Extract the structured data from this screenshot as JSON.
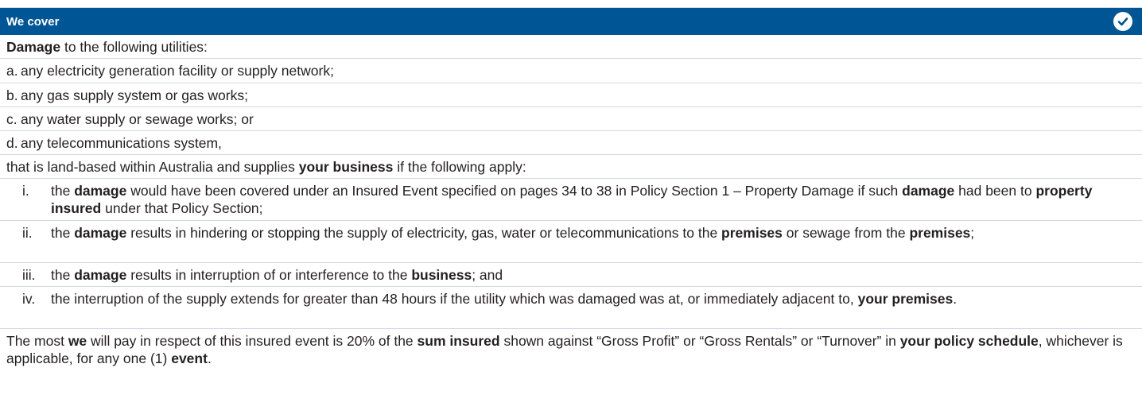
{
  "header": {
    "title": "We cover",
    "icon": "check-circle-icon",
    "bg": "#005694"
  },
  "intro": {
    "b1": "Damage",
    "t1": " to the following utilities:"
  },
  "list": [
    {
      "label": "a.",
      "text": "any electricity generation facility or supply network;"
    },
    {
      "label": "b.",
      "text": "any gas supply system or gas works;"
    },
    {
      "label": "c.",
      "text": "any water supply or sewage works; or"
    },
    {
      "label": "d.",
      "text": "any telecommunications system,"
    }
  ],
  "condition": {
    "t1": "that is land-based within Australia and supplies ",
    "b1": "your business",
    "t2": " if the following apply:"
  },
  "sub": {
    "i": {
      "label": "i.",
      "t1": "the ",
      "b1": "damage",
      "t2": " would have been covered under an Insured Event specified on pages 34 to 38 in Policy Section 1 – Property Damage if such ",
      "b2": "damage",
      "t3": " had been to ",
      "b3": "property insured",
      "t4": " under that Policy Section;"
    },
    "ii": {
      "label": "ii.",
      "t1": "the ",
      "b1": "damage",
      "t2": " results in hindering or stopping the supply of electricity, gas, water or telecommunications to the ",
      "b2": "premises",
      "t3": " or sewage from the ",
      "b3": "premises",
      "t4": ";"
    },
    "iii": {
      "label": "iii.",
      "t1": "the ",
      "b1": "damage",
      "t2": " results in interruption of or interference to the ",
      "b2": "business",
      "t3": "; and"
    },
    "iv": {
      "label": "iv.",
      "t1": "the interruption of the supply extends for greater than 48 hours if the utility which was damaged was at, or immediately adjacent to, ",
      "b1": "your premises",
      "t2": "."
    }
  },
  "footer": {
    "t1": "The most ",
    "b1": "we",
    "t2": " will pay in respect of this insured event is 20% of the ",
    "b2": "sum insured",
    "t3": " shown against “Gross Profit” or “Gross Rentals” or “Turnover” in ",
    "b3": "your policy schedule",
    "t4": ", whichever is applicable, for any one (1) ",
    "b4": "event",
    "t5": "."
  }
}
